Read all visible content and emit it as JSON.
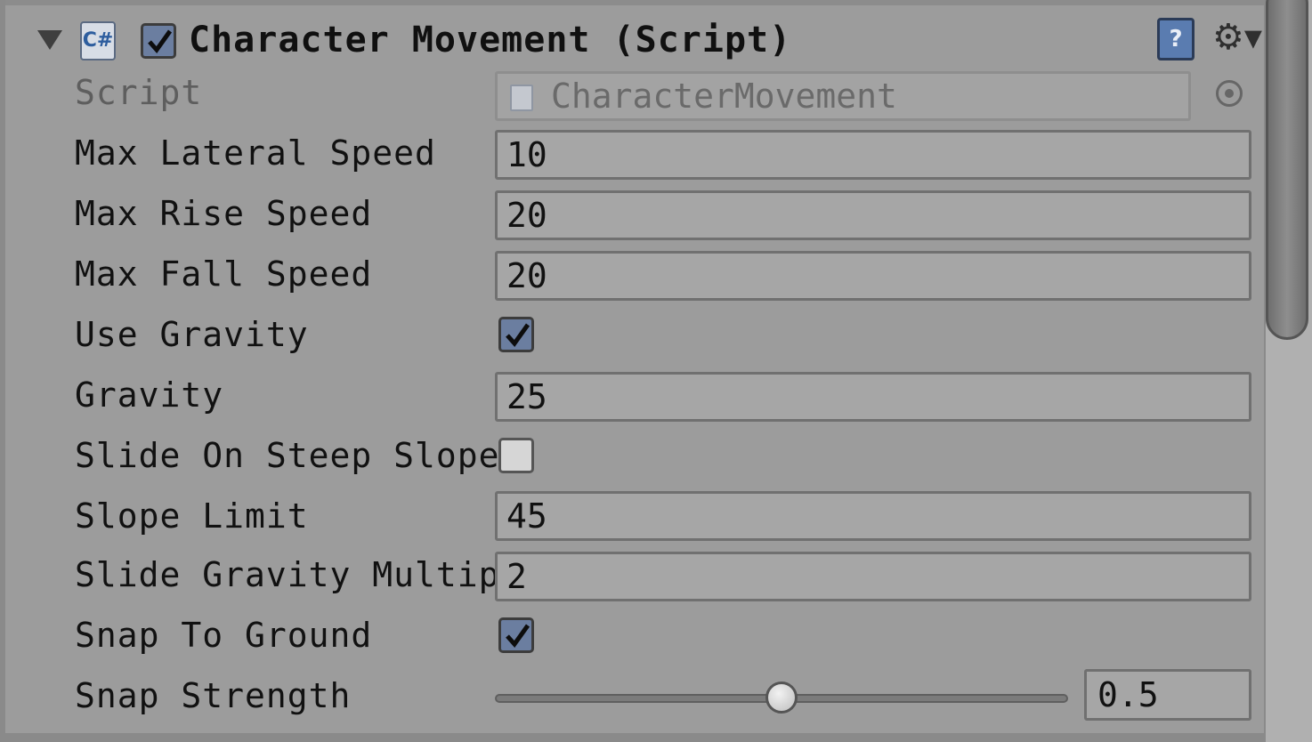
{
  "component": {
    "title": "Character Movement (Script)",
    "enabled": true,
    "help_glyph": "?",
    "settings_glyph": "⚙▾",
    "cs_glyph": "C#"
  },
  "rows": {
    "script": {
      "label": "Script",
      "value": "CharacterMovement"
    },
    "max_lateral_speed": {
      "label": "Max Lateral Speed",
      "value": "10"
    },
    "max_rise_speed": {
      "label": "Max Rise Speed",
      "value": "20"
    },
    "max_fall_speed": {
      "label": "Max Fall Speed",
      "value": "20"
    },
    "use_gravity": {
      "label": "Use Gravity",
      "checked": true
    },
    "gravity": {
      "label": "Gravity",
      "value": "25"
    },
    "slide_on_steep_slope": {
      "label": "Slide On Steep Slope",
      "checked": false
    },
    "slope_limit": {
      "label": "Slope Limit",
      "value": "45"
    },
    "slide_gravity_multiplier": {
      "label": "Slide Gravity Multiplie",
      "value": "2"
    },
    "snap_to_ground": {
      "label": "Snap To Ground",
      "checked": true
    },
    "snap_strength": {
      "label": "Snap Strength",
      "value": "0.5",
      "min": 0,
      "max": 1
    }
  },
  "icons": {
    "foldout": "foldout-arrow-icon",
    "script": "csharp-script-icon",
    "help": "help-book-icon",
    "settings": "gear-icon",
    "object_picker": "object-picker-icon"
  },
  "colors": {
    "panel_bg": "#9c9c9c",
    "checkbox_on": "#6b7ea0",
    "help_blue": "#5a7cb0"
  }
}
